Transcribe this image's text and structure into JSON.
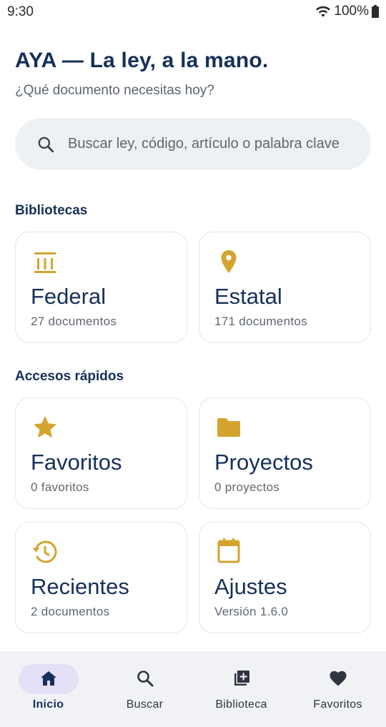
{
  "status": {
    "time": "9:30",
    "battery": "100%"
  },
  "header": {
    "title": "AYA — La ley, a la mano.",
    "subtitle": "¿Qué documento necesitas hoy?"
  },
  "search": {
    "placeholder": "Buscar ley, código, artículo o palabra clave"
  },
  "libraries": {
    "label": "Bibliotecas",
    "items": [
      {
        "title": "Federal",
        "subtitle": "27 documentos",
        "icon": "building-columns-icon"
      },
      {
        "title": "Estatal",
        "subtitle": "171 documentos",
        "icon": "location-pin-icon"
      }
    ]
  },
  "quick_access": {
    "label": "Accesos rápidos",
    "items": [
      {
        "title": "Favoritos",
        "subtitle": "0 favoritos",
        "icon": "star-icon"
      },
      {
        "title": "Proyectos",
        "subtitle": "0 proyectos",
        "icon": "folder-icon"
      },
      {
        "title": "Recientes",
        "subtitle": "2 documentos",
        "icon": "history-icon"
      },
      {
        "title": "Ajustes",
        "subtitle": "Versión 1.6.0",
        "icon": "calendar-icon"
      }
    ]
  },
  "bottom_nav": {
    "items": [
      {
        "label": "Inicio",
        "icon": "home-icon",
        "active": true
      },
      {
        "label": "Buscar",
        "icon": "search-icon",
        "active": false
      },
      {
        "label": "Biblioteca",
        "icon": "library-add-icon",
        "active": false
      },
      {
        "label": "Favoritos",
        "icon": "heart-icon",
        "active": false
      }
    ]
  },
  "colors": {
    "accent": "#d4a42e",
    "primary": "#16305a",
    "nav_active_pill": "#e4e0f7"
  }
}
